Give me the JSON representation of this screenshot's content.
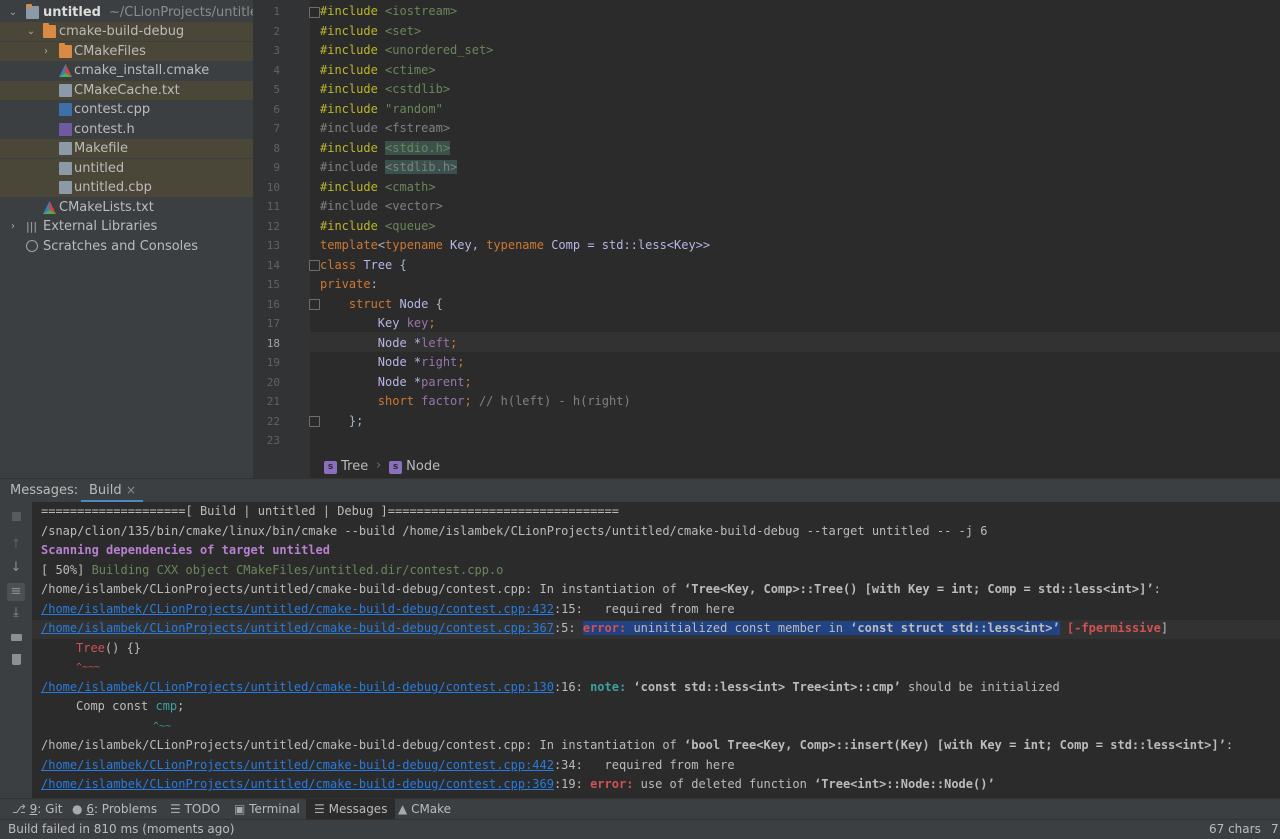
{
  "project_tree": {
    "root": {
      "label": "untitled",
      "path": "~/CLionProjects/untitled"
    },
    "items": [
      {
        "label": "cmake-build-debug"
      },
      {
        "label": "CMakeFiles"
      },
      {
        "label": "cmake_install.cmake"
      },
      {
        "label": "CMakeCache.txt"
      },
      {
        "label": "contest.cpp"
      },
      {
        "label": "contest.h"
      },
      {
        "label": "Makefile"
      },
      {
        "label": "untitled"
      },
      {
        "label": "untitled.cbp"
      },
      {
        "label": "CMakeLists.txt"
      },
      {
        "label": "External Libraries"
      },
      {
        "label": "Scratches and Consoles"
      }
    ]
  },
  "editor": {
    "current_line": "18",
    "line_numbers": [
      "1",
      "2",
      "3",
      "4",
      "5",
      "6",
      "7",
      "8",
      "9",
      "10",
      "11",
      "12",
      "13",
      "14",
      "15",
      "16",
      "17",
      "18",
      "19",
      "20",
      "21",
      "22",
      "23"
    ],
    "code": {
      "l1": {
        "a": "#include",
        "b": " <iostream>"
      },
      "l2": {
        "a": "#include",
        "b": " <set>"
      },
      "l3": {
        "a": "#include",
        "b": " <unordered_set>"
      },
      "l4": {
        "a": "#include",
        "b": " <ctime>"
      },
      "l5": {
        "a": "#include",
        "b": " <cstdlib>"
      },
      "l6": {
        "a": "#include",
        "b": " \"random\""
      },
      "l7": {
        "a": "#include",
        "b": " <fstream>"
      },
      "l8": {
        "a": "#include",
        "b": "<stdio.h>"
      },
      "l9": {
        "a": "#include",
        "b": "<stdlib.h>"
      },
      "l10": {
        "a": "#include",
        "b": " <cmath>"
      },
      "l11": {
        "a": "#include",
        "b": " <vector>"
      },
      "l12": {
        "a": "#include",
        "b": " <queue>"
      },
      "l13": {
        "a": "template",
        "b": "<",
        "c": "typename",
        "d": " Key, ",
        "e": "typename",
        "f": " Comp = std::less<Key>>"
      },
      "l14": {
        "a": "class",
        "b": " Tree ",
        "c": "{"
      },
      "l15": {
        "a": "private",
        "b": ":"
      },
      "l16": {
        "a": "    struct",
        "b": " Node ",
        "c": "{"
      },
      "l17": {
        "a": "        Key ",
        "b": "key",
        "c": ";"
      },
      "l18": {
        "a": "        Node *",
        "b": "left",
        "c": ";"
      },
      "l19": {
        "a": "        Node *",
        "b": "right",
        "c": ";"
      },
      "l20": {
        "a": "        Node *",
        "b": "parent",
        "c": ";"
      },
      "l21": {
        "a": "        short",
        "b": " factor",
        "c": ";",
        "d": " // h(left) - h(right)"
      },
      "l22": {
        "a": "    };"
      }
    },
    "breadcrumb": {
      "badge": "s",
      "first": "Tree",
      "sep": "›",
      "second": "Node"
    }
  },
  "messages": {
    "label": "Messages:",
    "tab": "Build",
    "tab_close": "×",
    "lines": {
      "m1": "====================[ Build | untitled | Debug ]================================",
      "m2": "/snap/clion/135/bin/cmake/linux/bin/cmake --build /home/islambek/CLionProjects/untitled/cmake-build-debug --target untitled -- -j 6",
      "m3": "Scanning dependencies of target untitled",
      "m4": {
        "a": "[ 50%] ",
        "b": "Building CXX object CMakeFiles/untitled.dir/contest.cpp.o"
      },
      "m5": {
        "a": "/home/islambek/CLionProjects/untitled/cmake-build-debug/contest.cpp: In instantiation of ",
        "b": "‘Tree<Key, Comp>::Tree() [with Key = int; Comp = std::less<int>]’",
        "c": ":"
      },
      "m6": {
        "link": "/home/islambek/CLionProjects/untitled/cmake-build-debug/contest.cpp:432",
        "rest": ":15:   required from here"
      },
      "m7": {
        "link": "/home/islambek/CLionProjects/untitled/cmake-build-debug/contest.cpp:367",
        "pos": ":5: ",
        "err": "error:",
        "msg": " uninitialized const member in ",
        "q": "‘const struct std::less<int>’",
        "flag": " [-fpermissive",
        "end": "]"
      },
      "m8": {
        "a": "Tree",
        "b": "() {}"
      },
      "m9": "^~~~",
      "m10": {
        "link": "/home/islambek/CLionProjects/untitled/cmake-build-debug/contest.cpp:130",
        "pos": ":16: ",
        "note": "note:",
        "q": " ‘const std::less<int> Tree<int>::cmp’",
        "rest": " should be initialized"
      },
      "m11": {
        "a": "Comp const ",
        "b": "cmp",
        "c": ";"
      },
      "m12": "^~~",
      "m13": {
        "a": "/home/islambek/CLionProjects/untitled/cmake-build-debug/contest.cpp: In instantiation of ",
        "b": "‘bool Tree<Key, Comp>::insert(Key) [with Key = int; Comp = std::less<int>]’",
        "c": ":"
      },
      "m14": {
        "link": "/home/islambek/CLionProjects/untitled/cmake-build-debug/contest.cpp:442",
        "rest": ":34:   required from here"
      },
      "m15": {
        "link": "/home/islambek/CLionProjects/untitled/cmake-build-debug/contest.cpp:369",
        "pos": ":19: ",
        "err": "error:",
        "msg": " use of deleted function ",
        "q": "‘Tree<int>::Node::Node()’"
      }
    }
  },
  "tool_windows": {
    "git": {
      "num": "9",
      "label": ": Git"
    },
    "problems": {
      "num": "6",
      "label": ": Problems"
    },
    "todo": "TODO",
    "terminal": "Terminal",
    "messages": "Messages",
    "cmake": "CMake"
  },
  "status_bar": {
    "message": "Build failed in 810 ms (moments ago)",
    "chars": "67 chars",
    "extra": "7"
  },
  "colors": {
    "editor_bg": "#2b2b2b",
    "panel_bg": "#3c3f41",
    "keyword": "#cc7832",
    "string": "#6a8759",
    "link": "#287bde",
    "error": "#d25252"
  }
}
